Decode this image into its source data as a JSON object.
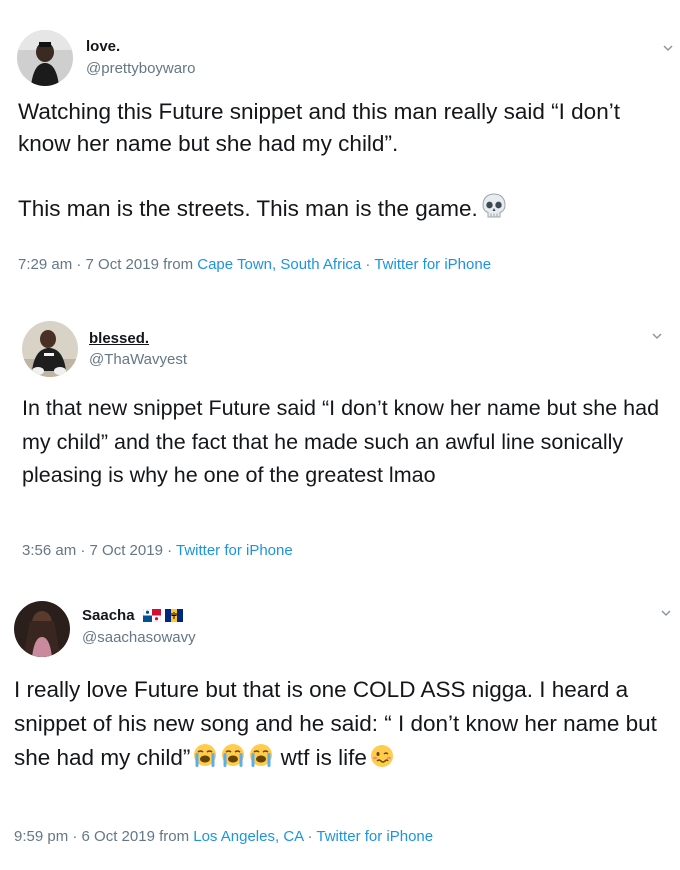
{
  "tweets": [
    {
      "display_name": "love.",
      "handle": "@prettyboywaro",
      "text": "Watching this Future snippet and this man really said “I don’t know her name but she had my child”.\n\nThis man is the streets. This man is the game.",
      "emoji": "skull-icon",
      "time": "7:29 am · 7 Oct 2019 from ",
      "location": "Cape Town, South Africa",
      "sep": " · ",
      "source": "Twitter for iPhone"
    },
    {
      "display_name": "blessed.",
      "handle": "@ThaWavyest",
      "text": "In that new snippet Future said “I don’t know her name but she had my child” and the fact that he made such an awful line sonically pleasing is why he one of the greatest lmao",
      "time": "3:56 am · 7 Oct 2019",
      "sep": " · ",
      "source": "Twitter for iPhone"
    },
    {
      "display_name": "Saacha",
      "flags": [
        "panama-flag-icon",
        "barbados-flag-icon"
      ],
      "handle": "@saachasowavy",
      "text_a": "I really love Future but that is one COLD ASS nigga. I heard a snippet of his new song and he said: “ I don’t know her name but she had my child”",
      "text_b": " wtf is life",
      "emoji": [
        "loudly-crying-face-icon",
        "loudly-crying-face-icon",
        "loudly-crying-face-icon",
        "woozy-face-icon"
      ],
      "time": "9:59 pm · 6 Oct 2019 from ",
      "location": "Los Angeles, CA",
      "sep": " · ",
      "source": "Twitter for iPhone"
    }
  ],
  "colors": {
    "text": "#14171a",
    "secondary": "#657786",
    "link": "#1b95e0",
    "divider": "#e1e8ed"
  }
}
